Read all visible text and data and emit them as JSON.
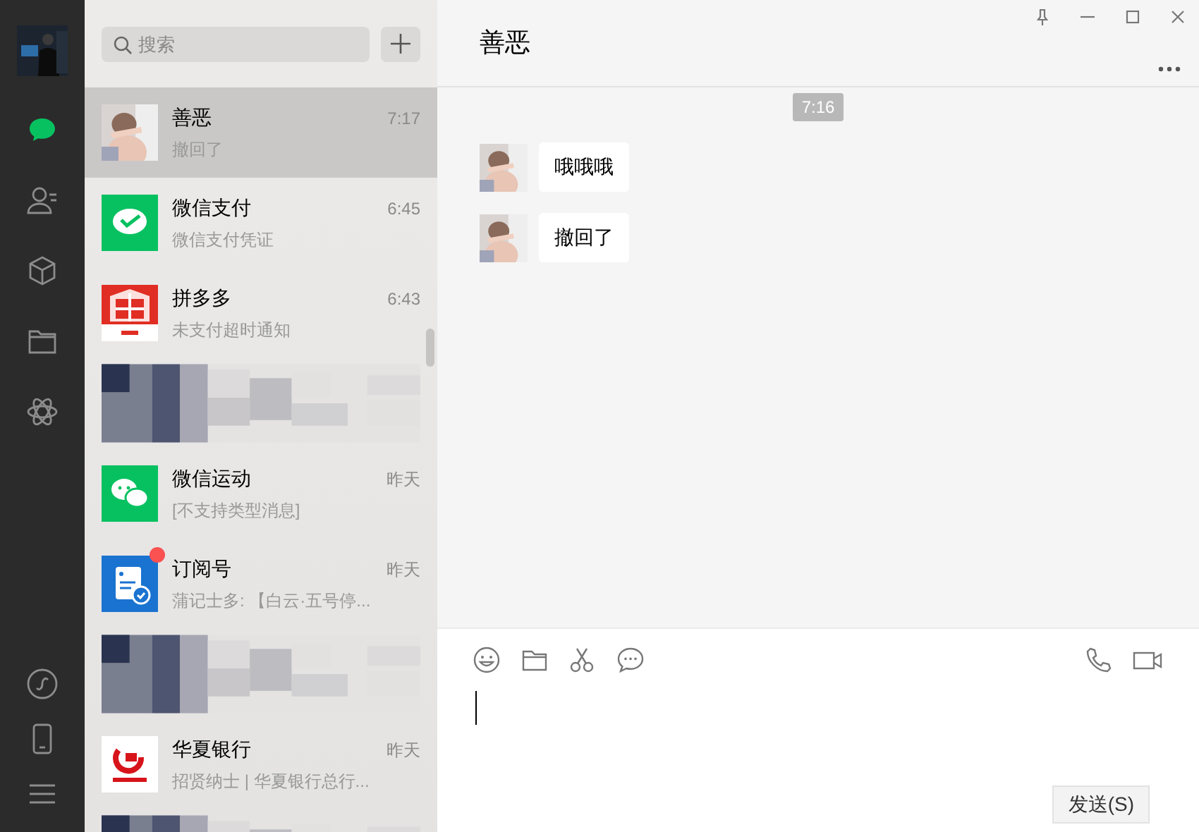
{
  "sidebar": {
    "items": [
      {
        "selected": true
      },
      {
        "selected": false
      },
      {
        "selected": false
      },
      {
        "selected": false
      },
      {
        "selected": false
      }
    ]
  },
  "search": {
    "placeholder": "搜索"
  },
  "chats": [
    {
      "kind": "chat",
      "name": "善恶",
      "preview": "撤回了",
      "time": "7:17",
      "selected": true,
      "unread": false
    },
    {
      "kind": "chat",
      "avatar": {
        "kind": "pay"
      },
      "name": "微信支付",
      "preview": "微信支付凭证",
      "time": "6:45",
      "selected": false,
      "unread": false
    },
    {
      "kind": "chat",
      "avatar": {
        "kind": "shop"
      },
      "name": "拼多多",
      "preview": "未支付超时通知",
      "time": "6:43",
      "selected": false,
      "unread": false
    },
    {
      "kind": "blurred"
    },
    {
      "kind": "chat",
      "avatar": {
        "kind": "bubbles"
      },
      "name": "微信运动",
      "preview": "[不支持类型消息]",
      "time": "昨天",
      "selected": false,
      "unread": false
    },
    {
      "kind": "chat",
      "avatar": {
        "kind": "document"
      },
      "name": "订阅号",
      "preview": "蒲记士多: 【白云·五号停...",
      "time": "昨天",
      "selected": false,
      "unread": true
    },
    {
      "kind": "blurred"
    },
    {
      "kind": "chat",
      "avatar": {
        "kind": "bank"
      },
      "name": "华夏银行",
      "preview": "招贤纳士 | 华夏银行总行...",
      "time": "昨天",
      "selected": false,
      "unread": false
    },
    {
      "kind": "blurred"
    }
  ],
  "conversation": {
    "title": "善恶",
    "timestamp": "7:16",
    "messages": [
      {
        "text": "哦哦哦"
      },
      {
        "text": "撤回了"
      }
    ],
    "send_button": "发送(S)"
  }
}
